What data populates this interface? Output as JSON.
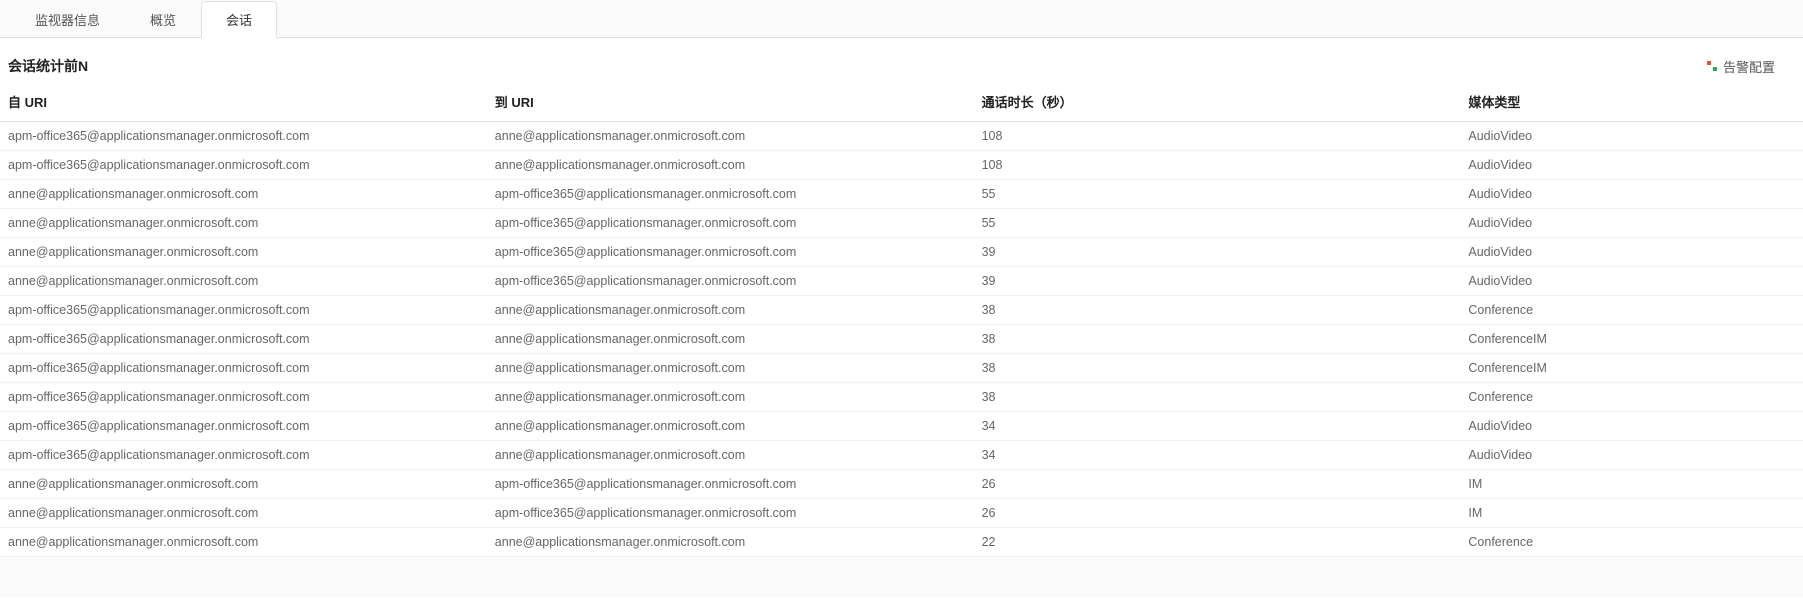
{
  "tabs": [
    {
      "label": "监视器信息",
      "active": false
    },
    {
      "label": "概览",
      "active": false
    },
    {
      "label": "会话",
      "active": true
    }
  ],
  "section": {
    "title": "会话统计前N",
    "alarm_label": "告警配置"
  },
  "table": {
    "headers": {
      "from": "自  URI",
      "to": "到  URI",
      "duration": "通话时长（秒）",
      "media": "媒体类型"
    },
    "rows": [
      {
        "from": "apm-office365@applicationsmanager.onmicrosoft.com",
        "to": "anne@applicationsmanager.onmicrosoft.com",
        "duration": "108",
        "media": "AudioVideo"
      },
      {
        "from": "apm-office365@applicationsmanager.onmicrosoft.com",
        "to": "anne@applicationsmanager.onmicrosoft.com",
        "duration": "108",
        "media": "AudioVideo"
      },
      {
        "from": "anne@applicationsmanager.onmicrosoft.com",
        "to": "apm-office365@applicationsmanager.onmicrosoft.com",
        "duration": "55",
        "media": "AudioVideo"
      },
      {
        "from": "anne@applicationsmanager.onmicrosoft.com",
        "to": "apm-office365@applicationsmanager.onmicrosoft.com",
        "duration": "55",
        "media": "AudioVideo"
      },
      {
        "from": "anne@applicationsmanager.onmicrosoft.com",
        "to": "apm-office365@applicationsmanager.onmicrosoft.com",
        "duration": "39",
        "media": "AudioVideo"
      },
      {
        "from": "anne@applicationsmanager.onmicrosoft.com",
        "to": "apm-office365@applicationsmanager.onmicrosoft.com",
        "duration": "39",
        "media": "AudioVideo"
      },
      {
        "from": "apm-office365@applicationsmanager.onmicrosoft.com",
        "to": "anne@applicationsmanager.onmicrosoft.com",
        "duration": "38",
        "media": "Conference"
      },
      {
        "from": "apm-office365@applicationsmanager.onmicrosoft.com",
        "to": "anne@applicationsmanager.onmicrosoft.com",
        "duration": "38",
        "media": "ConferenceIM"
      },
      {
        "from": "apm-office365@applicationsmanager.onmicrosoft.com",
        "to": "anne@applicationsmanager.onmicrosoft.com",
        "duration": "38",
        "media": "ConferenceIM"
      },
      {
        "from": "apm-office365@applicationsmanager.onmicrosoft.com",
        "to": "anne@applicationsmanager.onmicrosoft.com",
        "duration": "38",
        "media": "Conference"
      },
      {
        "from": "apm-office365@applicationsmanager.onmicrosoft.com",
        "to": "anne@applicationsmanager.onmicrosoft.com",
        "duration": "34",
        "media": "AudioVideo"
      },
      {
        "from": "apm-office365@applicationsmanager.onmicrosoft.com",
        "to": "anne@applicationsmanager.onmicrosoft.com",
        "duration": "34",
        "media": "AudioVideo"
      },
      {
        "from": "anne@applicationsmanager.onmicrosoft.com",
        "to": "apm-office365@applicationsmanager.onmicrosoft.com",
        "duration": "26",
        "media": "IM"
      },
      {
        "from": "anne@applicationsmanager.onmicrosoft.com",
        "to": "apm-office365@applicationsmanager.onmicrosoft.com",
        "duration": "26",
        "media": "IM"
      },
      {
        "from": "anne@applicationsmanager.onmicrosoft.com",
        "to": "anne@applicationsmanager.onmicrosoft.com",
        "duration": "22",
        "media": "Conference"
      }
    ]
  }
}
